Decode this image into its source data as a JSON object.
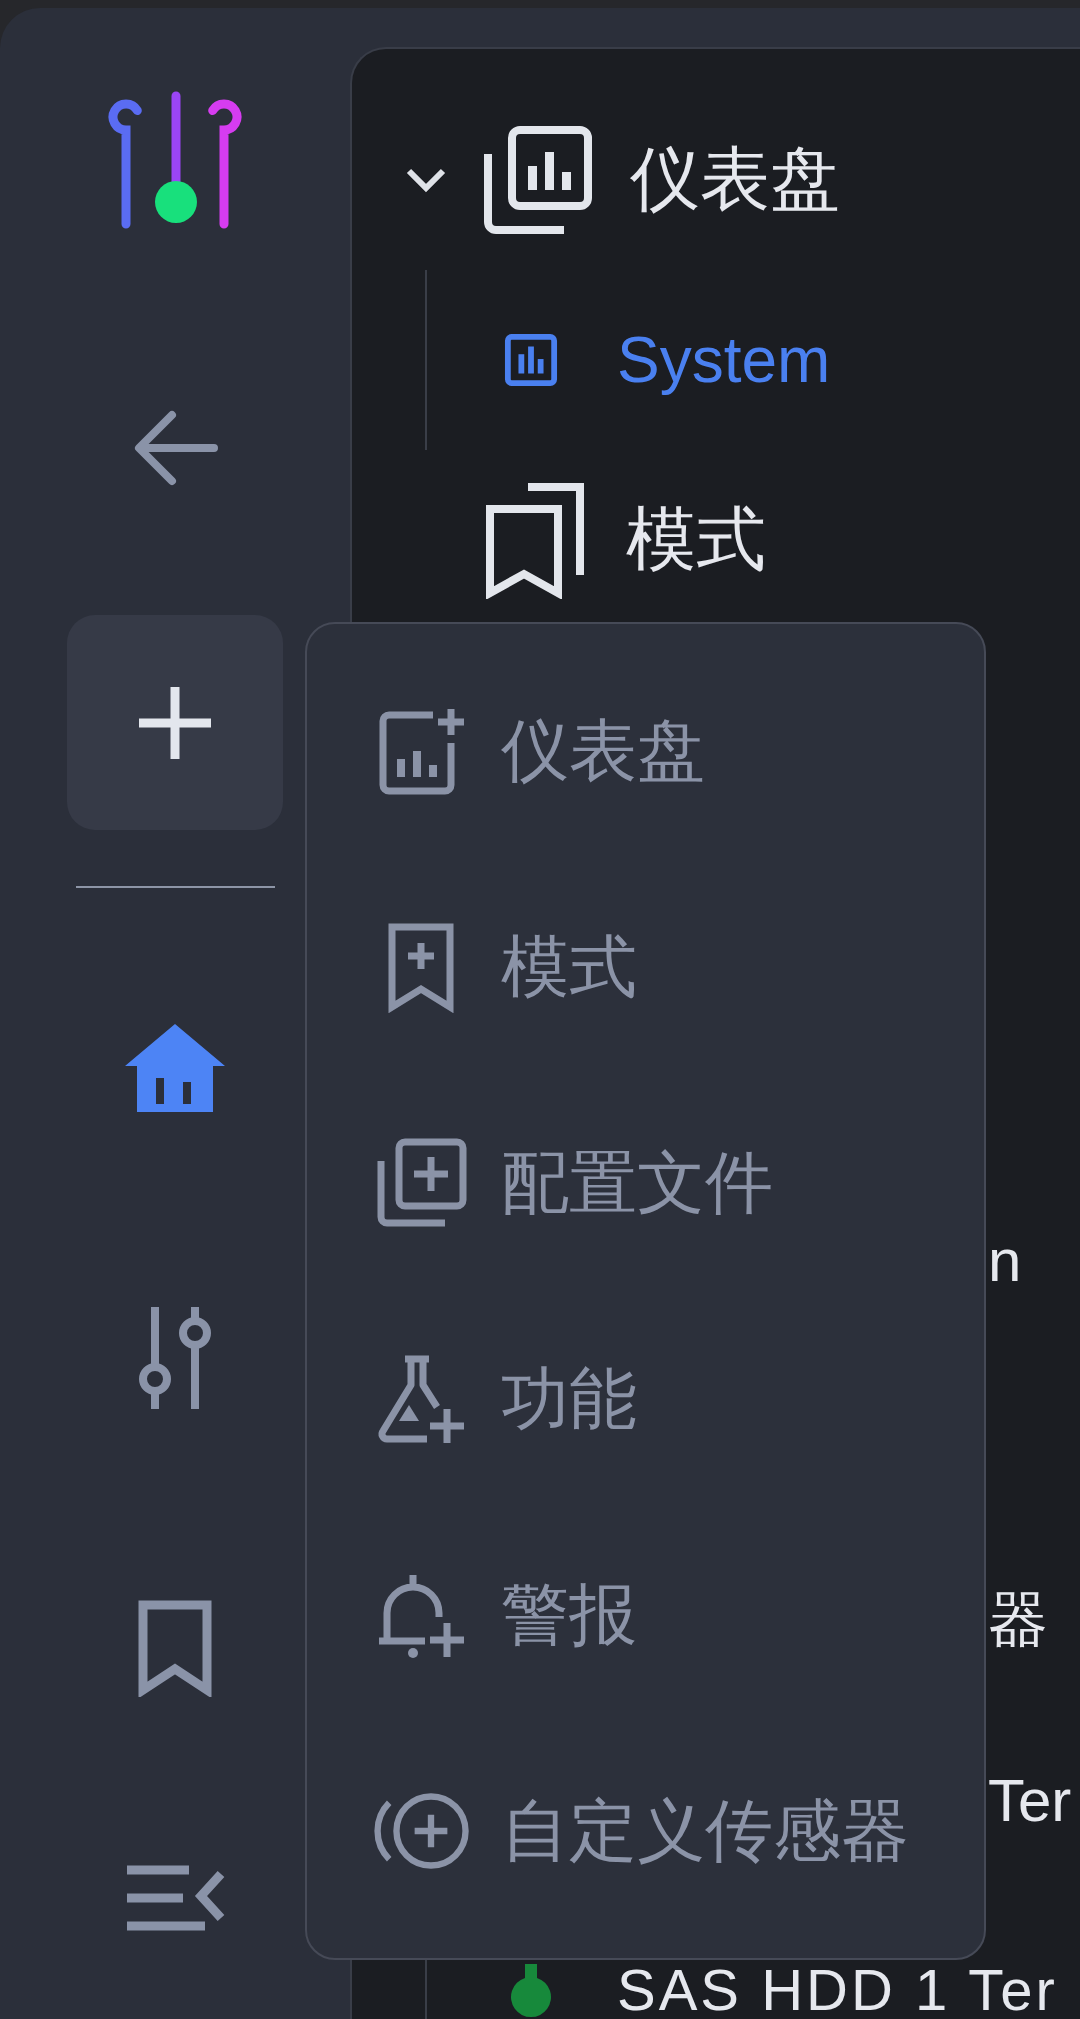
{
  "sidebar": {
    "nav": [
      {
        "kind": "home",
        "selected": true
      },
      {
        "kind": "sliders",
        "selected": false
      },
      {
        "kind": "bookmark",
        "selected": false
      }
    ]
  },
  "tree": {
    "rows": [
      {
        "kind": "dashboards",
        "label": "仪表盘",
        "selected": false,
        "expanded": true,
        "children": [
          {
            "kind": "dashboard",
            "label": "System",
            "selected": true
          }
        ]
      },
      {
        "kind": "modes",
        "label": "模式",
        "selected": false
      },
      {
        "kind": "fragment",
        "label": "n"
      },
      {
        "kind": "fragment",
        "label": "器",
        "children": [
          {
            "kind": "fragment",
            "label": "Ter"
          },
          {
            "kind": "sensor",
            "label": "SAS HDD 1 Ter",
            "selected": false,
            "color": "#17893b"
          }
        ]
      }
    ]
  },
  "add_menu": {
    "open": true,
    "items": [
      {
        "kind": "dashboard",
        "label": "仪表盘"
      },
      {
        "kind": "mode",
        "label": "模式"
      },
      {
        "kind": "profile",
        "label": "配置文件"
      },
      {
        "kind": "function",
        "label": "功能"
      },
      {
        "kind": "alert",
        "label": "警报"
      },
      {
        "kind": "sensor",
        "label": "自定义传感器"
      }
    ]
  }
}
